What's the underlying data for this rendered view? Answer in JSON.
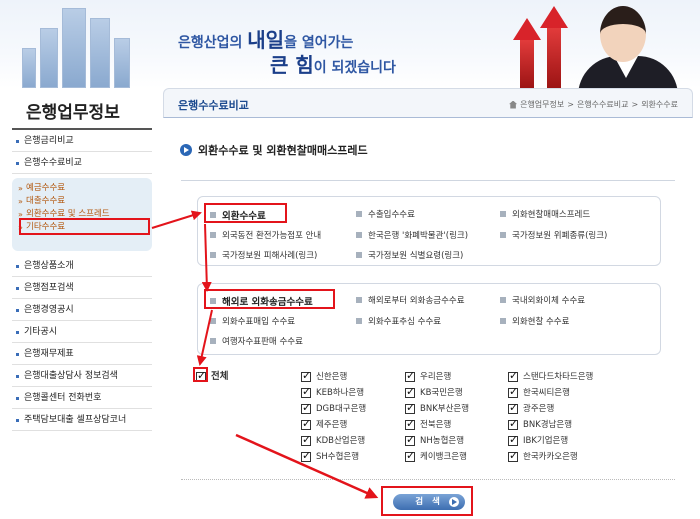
{
  "banner": {
    "line1_pre": "은행산업의 ",
    "line1_big": "내일",
    "line1_post": "을 열어가는",
    "line2_big": "큰 힘",
    "line2_post": "이 되겠습니다"
  },
  "sidebar": {
    "title": "은행업무정보",
    "items_top": [
      "은행금리비교",
      "은행수수료비교"
    ],
    "sub_items": [
      "예금수수료",
      "대출수수료",
      "외환수수료 및 스프레드",
      "기타수수료"
    ],
    "items_bottom": [
      "은행상품소개",
      "은행점포검색",
      "은행경영공시",
      "기타공시",
      "은행재무제표",
      "은행대출상담사 정보검색",
      "은행콜센터 전화번호",
      "주택담보대출 셀프상담코너"
    ]
  },
  "header": {
    "title": "은행수수료비교",
    "breadcrumb": [
      "은행업무정보",
      "은행수수료비교",
      "외환수수료"
    ]
  },
  "subtitle": "외환수수료 및 외환현찰매매스프레드",
  "group1": {
    "title": "외환수수료",
    "row1": [
      "수출입수수료",
      "외화현찰매매스프레드"
    ],
    "row2": [
      "외국동전 환전가능점포 안내",
      "한국은행 '화폐박물관'(링크)",
      "국가정보원 위폐종류(링크)"
    ],
    "row3": [
      "국가정보원 피해사례(링크)",
      "국가정보원 식별요령(링크)"
    ]
  },
  "group2": {
    "title": "해외로 외화송금수수료",
    "row1": [
      "해외로부터 외화송금수수료",
      "국내외화이체 수수료"
    ],
    "row2": [
      "외화수표매입 수수료",
      "외화수표추심 수수료",
      "외화현찰 수수료"
    ],
    "row3": [
      "여행자수표판매 수수료"
    ]
  },
  "banks": {
    "all_label": "전체",
    "list": [
      "신한은행",
      "우리은행",
      "스탠다드차타드은행",
      "KEB하나은행",
      "KB국민은행",
      "한국씨티은행",
      "DGB대구은행",
      "BNK부산은행",
      "광주은행",
      "제주은행",
      "전북은행",
      "BNK경남은행",
      "KDB산업은행",
      "NH농협은행",
      "IBK기업은행",
      "SH수협은행",
      "케이뱅크은행",
      "한국카카오은행"
    ]
  },
  "search_label": "검 색",
  "colors": {
    "accent": "#1c4a8f",
    "highlight": "#e3141b",
    "sub_item": "#b35a12"
  }
}
